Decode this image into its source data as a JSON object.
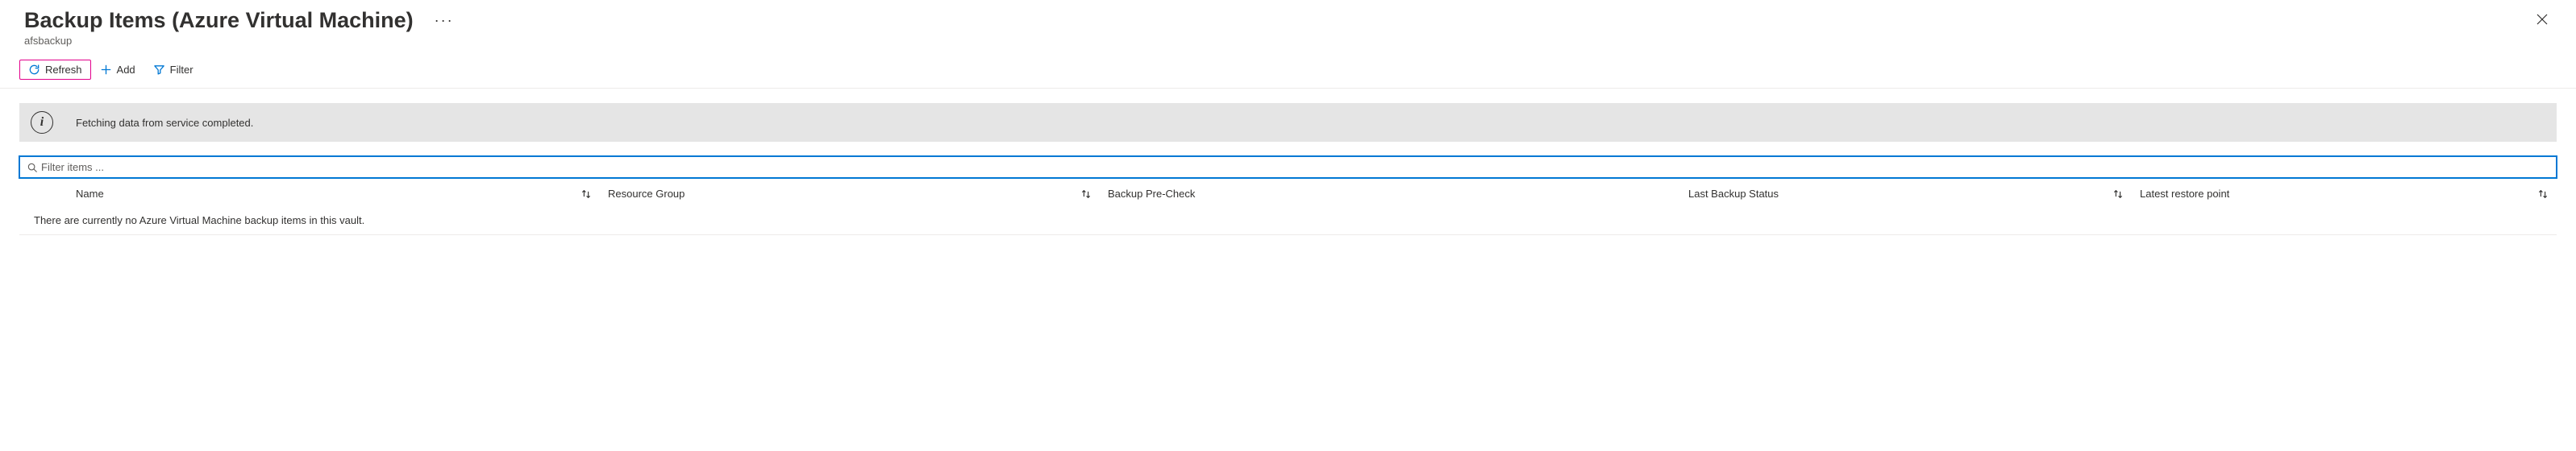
{
  "header": {
    "title": "Backup Items (Azure Virtual Machine)",
    "subtitle": "afsbackup",
    "more_label": "···"
  },
  "toolbar": {
    "refresh_label": "Refresh",
    "add_label": "Add",
    "filter_label": "Filter"
  },
  "info": {
    "message": "Fetching data from service completed."
  },
  "filter": {
    "placeholder": "Filter items ...",
    "value": ""
  },
  "columns": {
    "name": "Name",
    "resource_group": "Resource Group",
    "pre_check": "Backup Pre-Check",
    "last_status": "Last Backup Status",
    "latest_restore": "Latest restore point"
  },
  "empty_message": "There are currently no Azure Virtual Machine backup items in this vault."
}
